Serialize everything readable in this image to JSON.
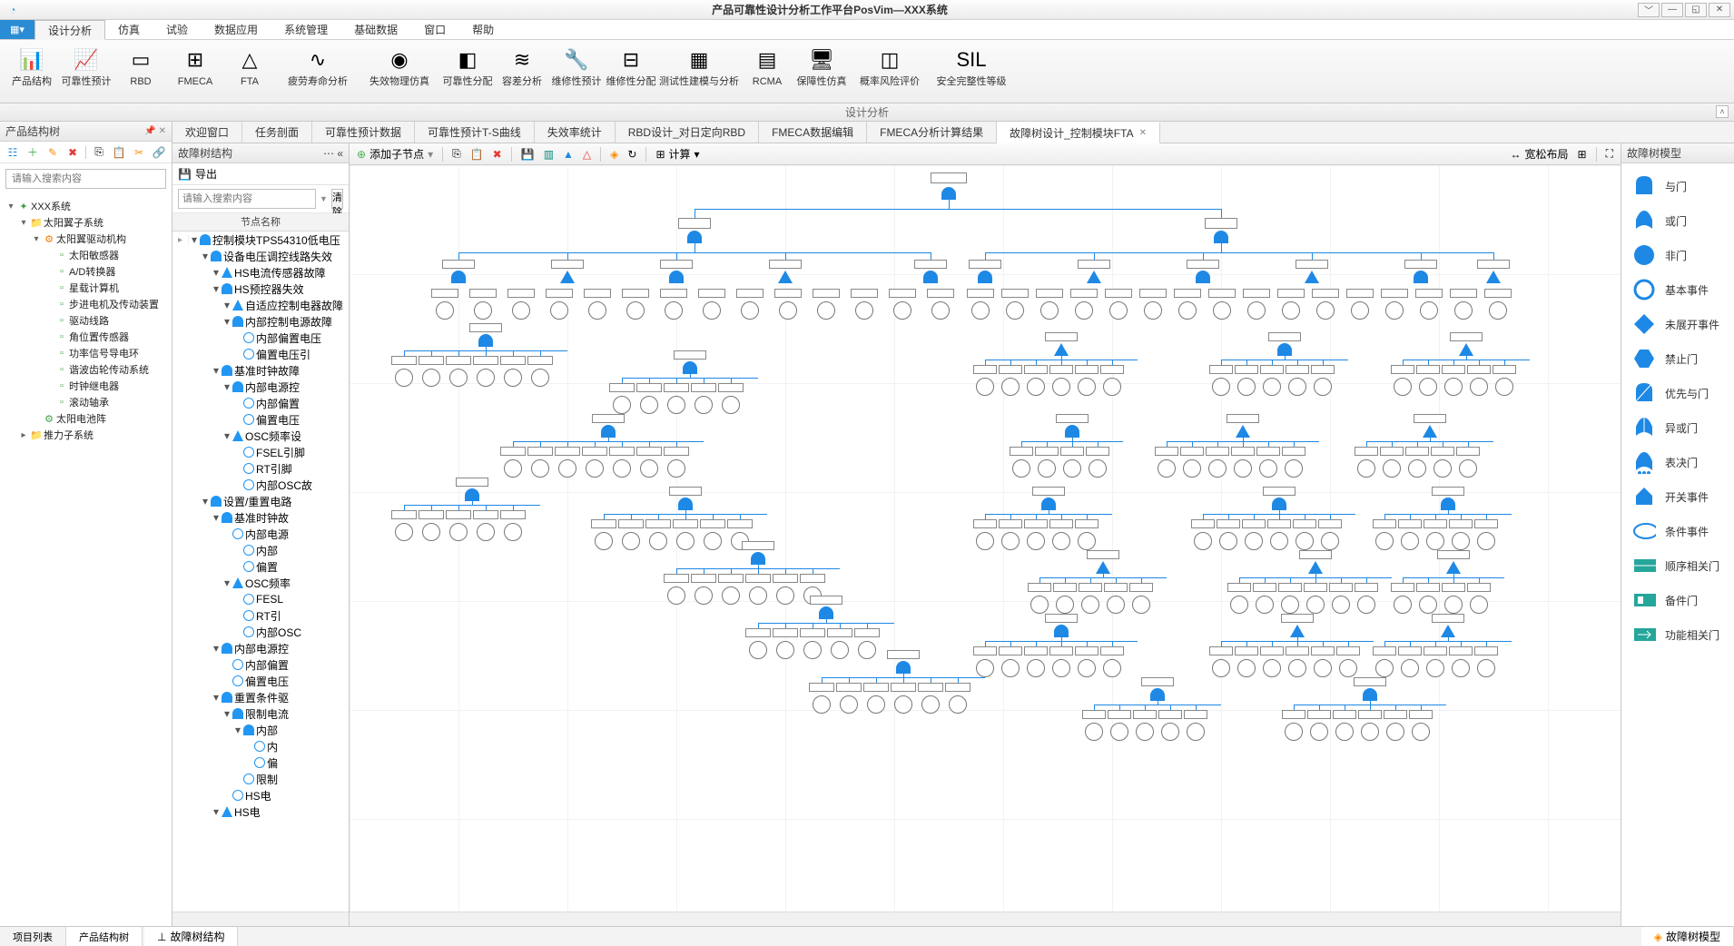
{
  "title": "产品可靠性设计分析工作平台PosVim—XXX系统",
  "menu_tabs": [
    "设计分析",
    "仿真",
    "试验",
    "数据应用",
    "系统管理",
    "基础数据",
    "窗口",
    "帮助"
  ],
  "menu_tabs_active": 0,
  "ribbon": [
    {
      "label": "产品结构",
      "icon": "📊"
    },
    {
      "label": "可靠性预计",
      "icon": "📈"
    },
    {
      "label": "RBD",
      "icon": "▭"
    },
    {
      "label": "FMECA",
      "icon": "⊞"
    },
    {
      "label": "FTA",
      "icon": "△"
    },
    {
      "label": "疲劳寿命分析",
      "icon": "∿"
    },
    {
      "label": "失效物理仿真",
      "icon": "◉"
    },
    {
      "label": "可靠性分配",
      "icon": "◧"
    },
    {
      "label": "容差分析",
      "icon": "≋"
    },
    {
      "label": "维修性预计",
      "icon": "🔧"
    },
    {
      "label": "维修性分配",
      "icon": "⊟"
    },
    {
      "label": "测试性建模与分析",
      "icon": "▦"
    },
    {
      "label": "RCMA",
      "icon": "▤"
    },
    {
      "label": "保障性仿真",
      "icon": "🖥"
    },
    {
      "label": "概率风险评价",
      "icon": "◫"
    },
    {
      "label": "安全完整性等级",
      "icon": "SIL"
    }
  ],
  "ribbon_caption": "设计分析",
  "left_panel": {
    "title": "产品结构树",
    "search_placeholder": "请输入搜索内容",
    "tree": [
      {
        "lv": 1,
        "exp": "▾",
        "icon": "✦",
        "label": "XXX系统"
      },
      {
        "lv": 2,
        "exp": "▾",
        "icon": "📁",
        "label": "太阳翼子系统",
        "color": "#1976d2"
      },
      {
        "lv": 3,
        "exp": "▾",
        "icon": "⚙",
        "label": "太阳翼驱动机构",
        "color": "#f57c00"
      },
      {
        "lv": 4,
        "exp": "",
        "icon": "▫",
        "label": "太阳敏感器"
      },
      {
        "lv": 4,
        "exp": "",
        "icon": "▫",
        "label": "A/D转换器"
      },
      {
        "lv": 4,
        "exp": "",
        "icon": "▫",
        "label": "星载计算机"
      },
      {
        "lv": 4,
        "exp": "",
        "icon": "▫",
        "label": "步进电机及传动装置"
      },
      {
        "lv": 4,
        "exp": "",
        "icon": "▫",
        "label": "驱动线路"
      },
      {
        "lv": 4,
        "exp": "",
        "icon": "▫",
        "label": "角位置传感器"
      },
      {
        "lv": 4,
        "exp": "",
        "icon": "▫",
        "label": "功率信号导电环"
      },
      {
        "lv": 4,
        "exp": "",
        "icon": "▫",
        "label": "谐波齿轮传动系统"
      },
      {
        "lv": 4,
        "exp": "",
        "icon": "▫",
        "label": "时钟继电器"
      },
      {
        "lv": 4,
        "exp": "",
        "icon": "▫",
        "label": "滚动轴承"
      },
      {
        "lv": 3,
        "exp": "",
        "icon": "⚙",
        "label": "太阳电池阵"
      },
      {
        "lv": 2,
        "exp": "▸",
        "icon": "📁",
        "label": "推力子系统"
      }
    ]
  },
  "doc_tabs": [
    {
      "label": "欢迎窗口"
    },
    {
      "label": "任务剖面"
    },
    {
      "label": "可靠性预计数据"
    },
    {
      "label": "可靠性预计T-S曲线"
    },
    {
      "label": "失效率统计"
    },
    {
      "label": "RBD设计_对日定向RBD"
    },
    {
      "label": "FMECA数据编辑"
    },
    {
      "label": "FMECA分析计算结果"
    },
    {
      "label": "故障树设计_控制模块FTA",
      "active": true,
      "closable": true
    }
  ],
  "ft_panel": {
    "title": "故障树结构",
    "export": "导出",
    "search_placeholder": "请输入搜索内容",
    "clear": "清除",
    "col": "节点名称",
    "rows": [
      {
        "d": 0,
        "g": "and",
        "t": "控制模块TPS54310低电压",
        "gutter": "▸"
      },
      {
        "d": 1,
        "g": "and",
        "t": "设备电压调控线路失效"
      },
      {
        "d": 2,
        "g": "or",
        "t": "HS电流传感器故障"
      },
      {
        "d": 2,
        "g": "and",
        "t": "HS预控器失效"
      },
      {
        "d": 3,
        "g": "or",
        "t": "自适应控制电器故障"
      },
      {
        "d": 3,
        "g": "and",
        "t": "内部控制电源故障"
      },
      {
        "d": 4,
        "g": "ev",
        "t": "内部偏置电压"
      },
      {
        "d": 4,
        "g": "ev",
        "t": "偏置电压引"
      },
      {
        "d": 2,
        "g": "and",
        "t": "基准时钟故障"
      },
      {
        "d": 3,
        "g": "and",
        "t": "内部电源控"
      },
      {
        "d": 4,
        "g": "ev",
        "t": "内部偏置"
      },
      {
        "d": 4,
        "g": "ev",
        "t": "偏置电压"
      },
      {
        "d": 3,
        "g": "or",
        "t": "OSC频率设"
      },
      {
        "d": 4,
        "g": "ev",
        "t": "FSEL引脚"
      },
      {
        "d": 4,
        "g": "ev",
        "t": "RT引脚"
      },
      {
        "d": 4,
        "g": "ev",
        "t": "内部OSC故"
      },
      {
        "d": 1,
        "g": "and",
        "t": "设置/重置电路"
      },
      {
        "d": 2,
        "g": "and",
        "t": "基准时钟故"
      },
      {
        "d": 3,
        "g": "ev",
        "t": "内部电源"
      },
      {
        "d": 4,
        "g": "ev",
        "t": "内部"
      },
      {
        "d": 4,
        "g": "ev",
        "t": "偏置"
      },
      {
        "d": 3,
        "g": "or",
        "t": "OSC频率"
      },
      {
        "d": 4,
        "g": "ev",
        "t": "FESL"
      },
      {
        "d": 4,
        "g": "ev",
        "t": "RT引"
      },
      {
        "d": 4,
        "g": "ev",
        "t": "内部OSC"
      },
      {
        "d": 2,
        "g": "and",
        "t": "内部电源控"
      },
      {
        "d": 3,
        "g": "ev",
        "t": "内部偏置"
      },
      {
        "d": 3,
        "g": "ev",
        "t": "偏置电压"
      },
      {
        "d": 2,
        "g": "and",
        "t": "重置条件驱"
      },
      {
        "d": 3,
        "g": "and",
        "t": "限制电流"
      },
      {
        "d": 4,
        "g": "and",
        "t": "内部"
      },
      {
        "d": 5,
        "g": "ev",
        "t": "内"
      },
      {
        "d": 5,
        "g": "ev",
        "t": "偏"
      },
      {
        "d": 4,
        "g": "ev",
        "t": "限制"
      },
      {
        "d": 3,
        "g": "ev",
        "t": "HS电"
      },
      {
        "d": 2,
        "g": "or",
        "t": "HS电"
      }
    ]
  },
  "canvas_toolbar": {
    "add_child": "添加子节点",
    "calc": "计算",
    "layout": "宽松布局"
  },
  "palette": {
    "title": "故障树模型",
    "items": [
      {
        "label": "与门",
        "shape": "and"
      },
      {
        "label": "或门",
        "shape": "or"
      },
      {
        "label": "非门",
        "shape": "not"
      },
      {
        "label": "基本事件",
        "shape": "circle"
      },
      {
        "label": "未展开事件",
        "shape": "diamond"
      },
      {
        "label": "禁止门",
        "shape": "hex"
      },
      {
        "label": "优先与门",
        "shape": "pand"
      },
      {
        "label": "异或门",
        "shape": "xor"
      },
      {
        "label": "表决门",
        "shape": "vote"
      },
      {
        "label": "开关事件",
        "shape": "house"
      },
      {
        "label": "条件事件",
        "shape": "ellipse"
      },
      {
        "label": "顺序相关门",
        "shape": "seq"
      },
      {
        "label": "备件门",
        "shape": "spare"
      },
      {
        "label": "功能相关门",
        "shape": "fdep"
      }
    ]
  },
  "bottom_tabs_left": [
    "项目列表",
    "产品结构树"
  ],
  "bottom_tabs_left_active": 1,
  "bottom_tab_mid": "故障树结构",
  "bottom_tab_right": "故障树模型"
}
